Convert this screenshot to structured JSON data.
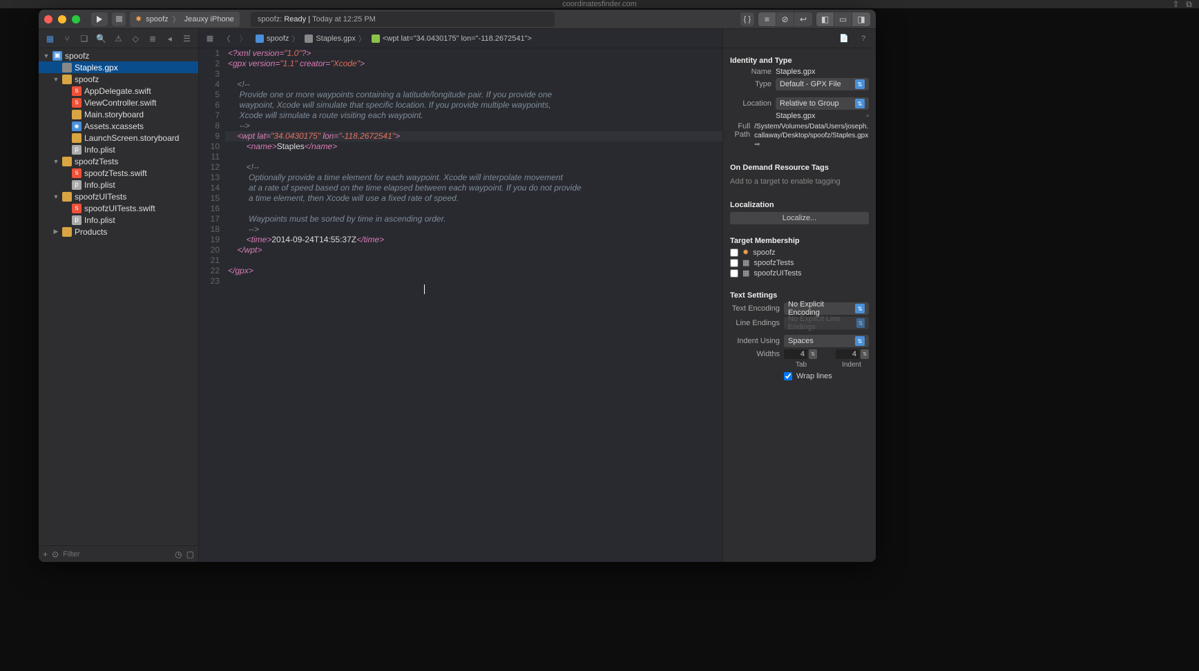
{
  "browser_hint": "coordinatesfinder.com",
  "toolbar": {
    "scheme_name": "spoofz",
    "destination": "Jeauxy iPhone",
    "status_app": "spoofz:",
    "status_state": "Ready |",
    "status_time": "Today at 12:25 PM"
  },
  "navigator": {
    "filter_placeholder": "Filter",
    "tree": [
      {
        "depth": 0,
        "kind": "proj",
        "disclosure": "▼",
        "label": "spoofz"
      },
      {
        "depth": 1,
        "kind": "file",
        "disclosure": "",
        "label": "Staples.gpx",
        "selected": true
      },
      {
        "depth": 1,
        "kind": "folder",
        "disclosure": "▼",
        "label": "spoofz"
      },
      {
        "depth": 2,
        "kind": "swift",
        "disclosure": "",
        "label": "AppDelegate.swift"
      },
      {
        "depth": 2,
        "kind": "swift",
        "disclosure": "",
        "label": "ViewController.swift"
      },
      {
        "depth": 2,
        "kind": "story",
        "disclosure": "",
        "label": "Main.storyboard"
      },
      {
        "depth": 2,
        "kind": "assets",
        "disclosure": "",
        "label": "Assets.xcassets"
      },
      {
        "depth": 2,
        "kind": "story",
        "disclosure": "",
        "label": "LaunchScreen.storyboard"
      },
      {
        "depth": 2,
        "kind": "plist",
        "disclosure": "",
        "label": "Info.plist"
      },
      {
        "depth": 1,
        "kind": "folder",
        "disclosure": "▼",
        "label": "spoofzTests"
      },
      {
        "depth": 2,
        "kind": "swift",
        "disclosure": "",
        "label": "spoofzTests.swift"
      },
      {
        "depth": 2,
        "kind": "plist",
        "disclosure": "",
        "label": "Info.plist"
      },
      {
        "depth": 1,
        "kind": "folder",
        "disclosure": "▼",
        "label": "spoofzUITests"
      },
      {
        "depth": 2,
        "kind": "swift",
        "disclosure": "",
        "label": "spoofzUITests.swift"
      },
      {
        "depth": 2,
        "kind": "plist",
        "disclosure": "",
        "label": "Info.plist"
      },
      {
        "depth": 1,
        "kind": "folder",
        "disclosure": "▶",
        "label": "Products"
      }
    ]
  },
  "jumpbar": {
    "crumbs": [
      {
        "icon": "proj",
        "label": "spoofz"
      },
      {
        "icon": "file",
        "label": "Staples.gpx"
      },
      {
        "icon": "func",
        "label": "wpt lat=\"34.0430175\" lon=\"-118.2672541\""
      }
    ]
  },
  "code": {
    "highlight_line": 9,
    "lines": [
      {
        "n": 1,
        "tokens": [
          [
            "tag",
            "<?xml "
          ],
          [
            "attr",
            "version="
          ],
          [
            "str",
            "\"1.0\""
          ],
          [
            "tag",
            "?>"
          ]
        ]
      },
      {
        "n": 2,
        "tokens": [
          [
            "tag",
            "<gpx "
          ],
          [
            "attr",
            "version="
          ],
          [
            "str",
            "\"1.1\" "
          ],
          [
            "attr",
            "creator="
          ],
          [
            "str",
            "\"Xcode\""
          ],
          [
            "tag",
            ">"
          ]
        ]
      },
      {
        "n": 3,
        "tokens": [
          [
            "txt",
            ""
          ]
        ]
      },
      {
        "n": 4,
        "tokens": [
          [
            "txt",
            "    "
          ],
          [
            "comment",
            "<!--"
          ]
        ]
      },
      {
        "n": 5,
        "tokens": [
          [
            "txt",
            "     "
          ],
          [
            "comment",
            "Provide one or more waypoints containing a latitude/longitude pair. If you provide one"
          ]
        ]
      },
      {
        "n": 6,
        "tokens": [
          [
            "txt",
            "     "
          ],
          [
            "comment",
            "waypoint, Xcode will simulate that specific location. If you provide multiple waypoints,"
          ]
        ]
      },
      {
        "n": 7,
        "tokens": [
          [
            "txt",
            "     "
          ],
          [
            "comment",
            "Xcode will simulate a route visiting each waypoint."
          ]
        ]
      },
      {
        "n": 8,
        "tokens": [
          [
            "txt",
            "     "
          ],
          [
            "comment",
            "-->"
          ]
        ]
      },
      {
        "n": 9,
        "tokens": [
          [
            "txt",
            "    "
          ],
          [
            "tag",
            "<wpt "
          ],
          [
            "attr",
            "lat="
          ],
          [
            "str",
            "\"34.0430175\" "
          ],
          [
            "attr",
            "lon="
          ],
          [
            "str",
            "\"-118.2672541\""
          ],
          [
            "tag",
            ">"
          ]
        ]
      },
      {
        "n": 10,
        "tokens": [
          [
            "txt",
            "        "
          ],
          [
            "tag",
            "<name>"
          ],
          [
            "txt",
            "Staples"
          ],
          [
            "tag",
            "</name>"
          ]
        ]
      },
      {
        "n": 11,
        "tokens": [
          [
            "txt",
            ""
          ]
        ]
      },
      {
        "n": 12,
        "tokens": [
          [
            "txt",
            "        "
          ],
          [
            "comment",
            "<!--"
          ]
        ]
      },
      {
        "n": 13,
        "tokens": [
          [
            "txt",
            "         "
          ],
          [
            "comment",
            "Optionally provide a time element for each waypoint. Xcode will interpolate movement"
          ]
        ]
      },
      {
        "n": 14,
        "tokens": [
          [
            "txt",
            "         "
          ],
          [
            "comment",
            "at a rate of speed based on the time elapsed between each waypoint. If you do not provide"
          ]
        ]
      },
      {
        "n": 15,
        "tokens": [
          [
            "txt",
            "         "
          ],
          [
            "comment",
            "a time element, then Xcode will use a fixed rate of speed."
          ]
        ]
      },
      {
        "n": 16,
        "tokens": [
          [
            "txt",
            ""
          ]
        ]
      },
      {
        "n": 17,
        "tokens": [
          [
            "txt",
            "         "
          ],
          [
            "comment",
            "Waypoints must be sorted by time in ascending order."
          ]
        ]
      },
      {
        "n": 18,
        "tokens": [
          [
            "txt",
            "         "
          ],
          [
            "comment",
            "-->"
          ]
        ]
      },
      {
        "n": 19,
        "tokens": [
          [
            "txt",
            "        "
          ],
          [
            "tag",
            "<time>"
          ],
          [
            "txt",
            "2014-09-24T14:55:37Z"
          ],
          [
            "tag",
            "</time>"
          ]
        ]
      },
      {
        "n": 20,
        "tokens": [
          [
            "txt",
            "    "
          ],
          [
            "tag",
            "</wpt>"
          ]
        ]
      },
      {
        "n": 21,
        "tokens": [
          [
            "txt",
            ""
          ]
        ]
      },
      {
        "n": 22,
        "tokens": [
          [
            "tag",
            "</gpx>"
          ]
        ]
      },
      {
        "n": 23,
        "tokens": [
          [
            "txt",
            ""
          ]
        ]
      }
    ]
  },
  "inspector": {
    "identity_hdr": "Identity and Type",
    "name_label": "Name",
    "name_value": "Staples.gpx",
    "type_label": "Type",
    "type_value": "Default - GPX File",
    "location_label": "Location",
    "location_value": "Relative to Group",
    "location_filename": "Staples.gpx",
    "fullpath_label": "Full Path",
    "fullpath_value": "/System/Volumes/Data/Users/joseph.callaway/Desktop/spoofz/Staples.gpx",
    "ondemand_hdr": "On Demand Resource Tags",
    "ondemand_placeholder": "Add to a target to enable tagging",
    "localization_hdr": "Localization",
    "localize_btn": "Localize...",
    "target_hdr": "Target Membership",
    "targets": [
      {
        "icon": "app",
        "label": "spoofz"
      },
      {
        "icon": "test",
        "label": "spoofzTests"
      },
      {
        "icon": "test",
        "label": "spoofzUITests"
      }
    ],
    "textsettings_hdr": "Text Settings",
    "encoding_label": "Text Encoding",
    "encoding_value": "No Explicit Encoding",
    "lineendings_label": "Line Endings",
    "lineendings_value": "No Explicit Line Endings",
    "indent_label": "Indent Using",
    "indent_value": "Spaces",
    "widths_label": "Widths",
    "tab_width": "4",
    "indent_width": "4",
    "tab_caption": "Tab",
    "indent_caption": "Indent",
    "wrap_label": "Wrap lines"
  }
}
